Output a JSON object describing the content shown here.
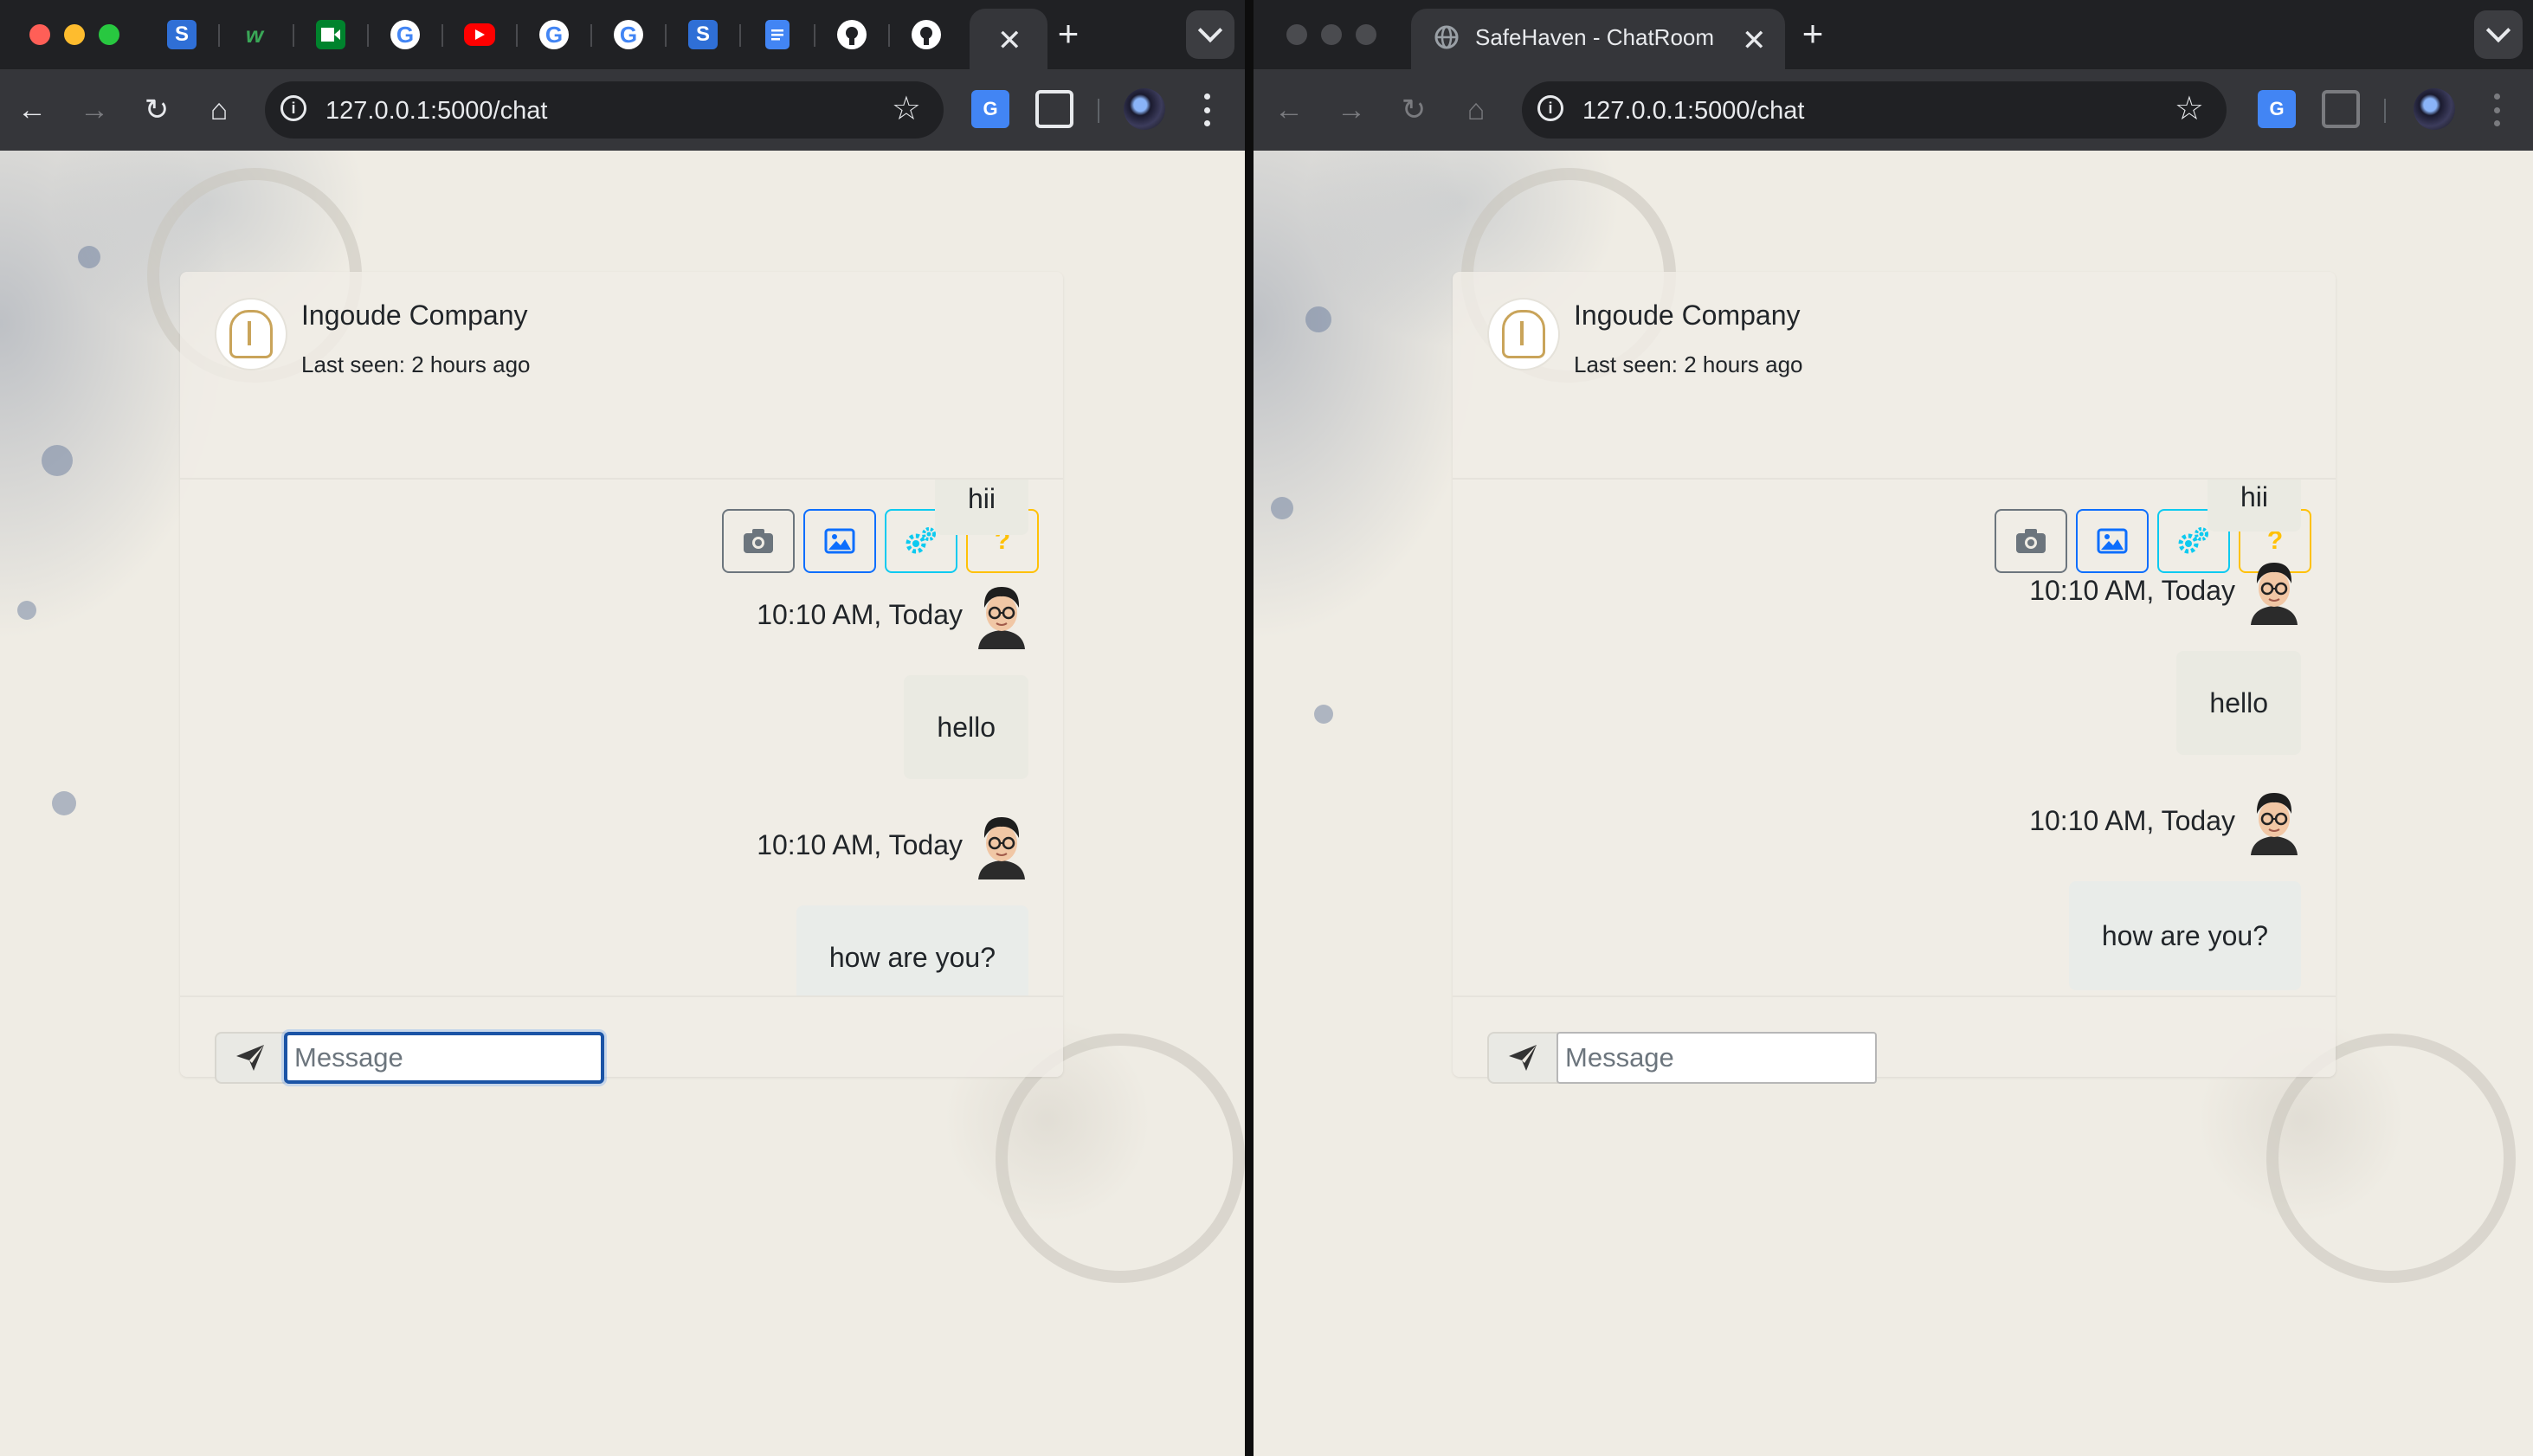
{
  "left_window": {
    "url": "127.0.0.1:5000/chat",
    "pinned_tabs": [
      "s-icon",
      "w-icon",
      "meet-icon",
      "google-icon",
      "youtube-icon",
      "google-icon",
      "google-icon",
      "s-icon",
      "docs-icon",
      "github-icon",
      "github-icon"
    ],
    "chat": {
      "company": "Ingoude Company",
      "last_seen": "Last seen: 2 hours ago",
      "messages": [
        {
          "text": "hii"
        },
        {
          "time": "10:10 AM, Today"
        },
        {
          "text": "hello"
        },
        {
          "time": "10:10 AM, Today"
        },
        {
          "text": "how are you?"
        }
      ],
      "input_placeholder": "Message"
    }
  },
  "right_window": {
    "tab_title": "SafeHaven - ChatRoom",
    "url": "127.0.0.1:5000/chat",
    "chat": {
      "company": "Ingoude Company",
      "last_seen": "Last seen: 2 hours ago",
      "messages": [
        {
          "text": "hii"
        },
        {
          "time": "10:10 AM, Today"
        },
        {
          "text": "hello"
        },
        {
          "time": "10:10 AM, Today"
        },
        {
          "text": "how are you?"
        }
      ],
      "input_placeholder": "Message"
    }
  },
  "header_buttons": {
    "camera": "camera-icon",
    "image": "image-icon",
    "settings": "gears-icon",
    "help": "?"
  },
  "colors": {
    "chrome_dark": "#202124",
    "toolbar": "#35363a",
    "page_bg": "#efece4",
    "btn_secondary": "#6c757d",
    "btn_primary": "#0d6efd",
    "btn_info": "#0dcaf0",
    "btn_warning": "#ffc107"
  }
}
